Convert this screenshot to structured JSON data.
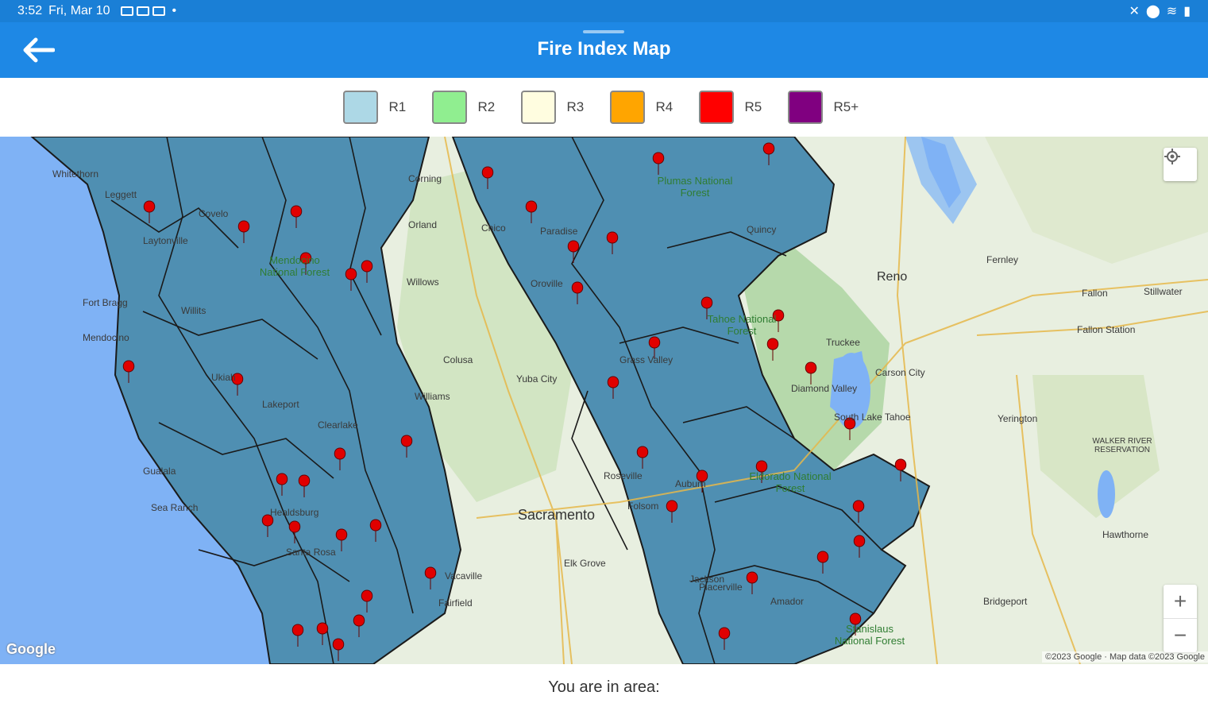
{
  "status": {
    "time": "3:52",
    "date": "Fri, Mar 10"
  },
  "appbar": {
    "title": "Fire Index Map",
    "back_icon": "arrow-left-icon"
  },
  "legend": [
    {
      "label": "R1",
      "color": "#add8e6"
    },
    {
      "label": "R2",
      "color": "#90ee90"
    },
    {
      "label": "R3",
      "color": "#fffde0"
    },
    {
      "label": "R4",
      "color": "#ffa500"
    },
    {
      "label": "R5",
      "color": "#ff0000"
    },
    {
      "label": "R5+",
      "color": "#800080"
    }
  ],
  "map": {
    "places": {
      "sacramento": "Sacramento",
      "reno": "Reno",
      "fallon": "Fallon",
      "fernley": "Fernley",
      "stillwater": "Stillwater",
      "fallon_station": "Fallon Station",
      "yerington": "Yerington",
      "hawthorne": "Hawthorne",
      "bridgeport": "Bridgeport",
      "carson_city": "Carson City",
      "truckee": "Truckee",
      "roseville": "Roseville",
      "folsom": "Folsom",
      "elk_grove": "Elk Grove",
      "yuba_city": "Yuba City",
      "willows": "Willows",
      "orland": "Orland",
      "corning": "Corning",
      "colusa": "Colusa",
      "williams": "Williams",
      "ukiah": "Ukiah",
      "willits": "Willits",
      "fort_bragg": "Fort Bragg",
      "mendocino": "Mendocino",
      "lakeport": "Lakeport",
      "clearlake": "Clearlake",
      "santa_rosa": "Santa Rosa",
      "healdsburg": "Healdsburg",
      "vacaville": "Vacaville",
      "fairfield": "Fairfield",
      "jackson": "Jackson",
      "paradise": "Paradise",
      "oroville": "Oroville",
      "grass_valley": "Grass Valley",
      "auburn": "Auburn",
      "placerville": "Placerville",
      "quincy": "Quincy",
      "chico": "Chico",
      "laytonville": "Laytonville",
      "covelo": "Covelo",
      "leggett": "Leggett",
      "whitethorn": "Whitethorn",
      "gualala": "Gualala",
      "sea_ranch": "Sea Ranch",
      "south_lake_tahoe": "South Lake Tahoe",
      "diamond_valley": "Diamond Valley",
      "amador": "Amador",
      "walker_river": "WALKER RIVER RESERVATION"
    },
    "forests": {
      "mendocino_nf": "Mendocino National Forest",
      "plumas_nf": "Plumas National Forest",
      "tahoe_nf": "Tahoe National Forest",
      "eldorado_nf": "Eldorado National Forest",
      "stanislaus_nf": "Stanislaus National Forest"
    },
    "google_logo": "Google",
    "copyright": "©2023 Google · Map data ©2023 Google",
    "zoom_in": "+",
    "zoom_out": "−",
    "colors": {
      "ocean": "#7fb2f5",
      "region": "#4f8fb2",
      "land": "#e8efe0",
      "green": "#a9d39e",
      "marker": "#e00000"
    }
  },
  "bottom": {
    "area_text": "You are in area:"
  }
}
